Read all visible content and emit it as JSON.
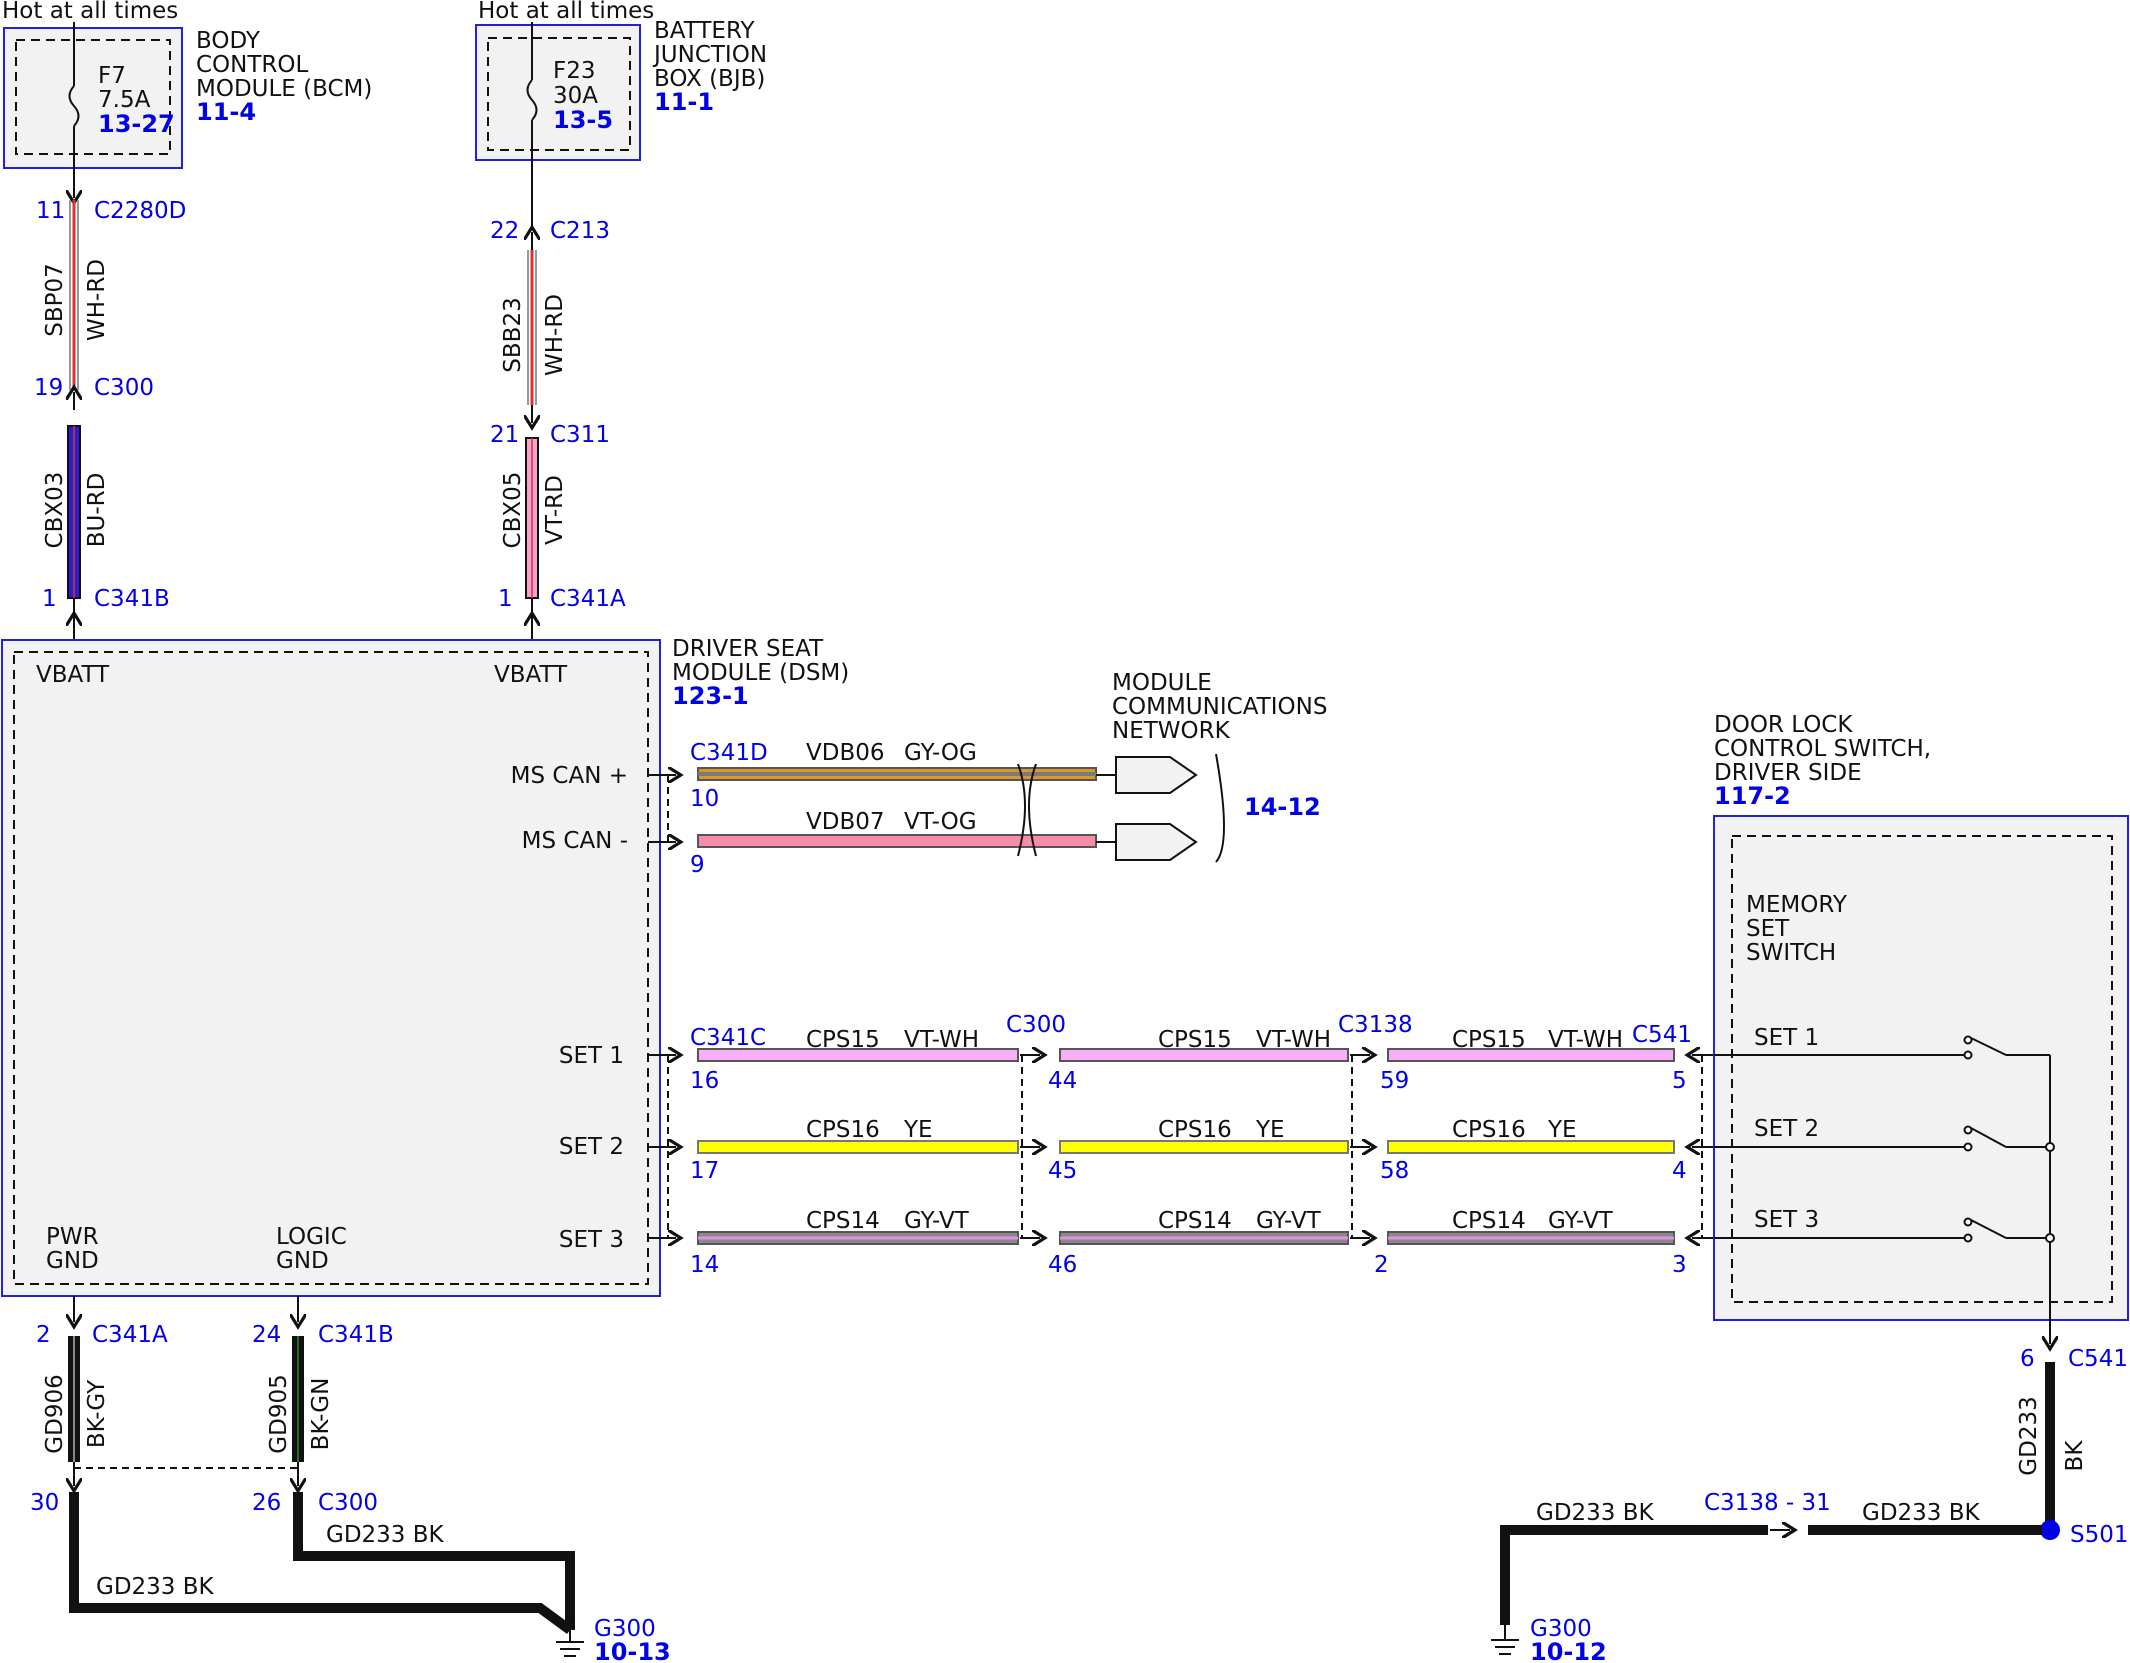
{
  "top_fuses": [
    {
      "supply": "Hot at all times",
      "fuse": "F7",
      "rating": "7.5A",
      "grid": "13-27",
      "module_lines": [
        "BODY",
        "CONTROL",
        "MODULE (BCM)"
      ],
      "module_ref": "11-4"
    },
    {
      "supply": "Hot at all times",
      "fuse": "F23",
      "rating": "30A",
      "grid": "13-5",
      "module_lines": [
        "BATTERY",
        "JUNCTION",
        "BOX (BJB)"
      ],
      "module_ref": "11-1"
    }
  ],
  "left_feed": {
    "pin_top": "11",
    "conn_top": "C2280D",
    "circuit_a": "SBP07",
    "color_a": "WH-RD",
    "pin_mid": "19",
    "conn_mid": "C300",
    "circuit_b": "CBX03",
    "color_b": "BU-RD",
    "pin_bot": "1",
    "conn_bot": "C341B"
  },
  "right_feed": {
    "pin_top": "22",
    "conn_top": "C213",
    "circuit_a": "SBB23",
    "color_a": "WH-RD",
    "pin_mid": "21",
    "conn_mid": "C311",
    "circuit_b": "CBX05",
    "color_b": "VT-RD",
    "pin_bot": "1",
    "conn_bot": "C341A"
  },
  "dsm": {
    "title_lines": [
      "DRIVER SEAT",
      "MODULE (DSM)"
    ],
    "ref": "123-1",
    "vbatt_left": "VBATT",
    "vbatt_right": "VBATT",
    "ms_can_plus": "MS CAN +",
    "ms_can_minus": "MS CAN -",
    "set1": "SET 1",
    "set2": "SET 2",
    "set3": "SET 3",
    "pwr_gnd": [
      "PWR",
      "GND"
    ],
    "logic_gnd": [
      "LOGIC",
      "GND"
    ]
  },
  "can": {
    "connector": "C341D",
    "plus": {
      "circuit": "VDB06",
      "color": "GY-OG",
      "pin": "10"
    },
    "minus": {
      "circuit": "VDB07",
      "color": "VT-OG",
      "pin": "9"
    },
    "network_lines": [
      "MODULE",
      "COMMUNICATIONS",
      "NETWORK"
    ],
    "network_ref": "14-12"
  },
  "set_circuits": {
    "connectors": [
      "C341C",
      "C300",
      "C3138",
      "C541"
    ],
    "rows": [
      {
        "circuit": "CPS15",
        "color": "VT-WH",
        "pins": [
          "16",
          "44",
          "59",
          "5"
        ]
      },
      {
        "circuit": "CPS16",
        "color": "YE",
        "pins": [
          "17",
          "45",
          "58",
          "4"
        ]
      },
      {
        "circuit": "CPS14",
        "color": "GY-VT",
        "pins": [
          "14",
          "46",
          "2",
          "3"
        ]
      }
    ]
  },
  "door_switch": {
    "title_lines": [
      "DOOR LOCK",
      "CONTROL SWITCH,",
      "DRIVER SIDE"
    ],
    "ref": "117-2",
    "inner_lines": [
      "MEMORY",
      "SET",
      "SWITCH"
    ],
    "set_labels": [
      "SET 1",
      "SET 2",
      "SET 3"
    ]
  },
  "ground_left": {
    "pwr_pin": "2",
    "pwr_conn": "C341A",
    "pwr_circuit": "GD906",
    "pwr_color": "BK-GY",
    "logic_pin": "24",
    "logic_conn": "C341B",
    "logic_circuit": "GD905",
    "logic_color": "BK-GN",
    "pin30": "30",
    "pin26": "26",
    "conn_c300": "C300",
    "wire_a": "GD233  BK",
    "wire_b": "GD233  BK",
    "ground": "G300",
    "ground_ref": "10-13"
  },
  "ground_right": {
    "pin": "6",
    "conn": "C541",
    "circuit": "GD233",
    "color": "BK",
    "splice": "S501",
    "inline_conn": "C3138 - 31",
    "wire_a": "GD233  BK",
    "wire_b": "GD233  BK",
    "ground": "G300",
    "ground_ref": "10-12"
  },
  "colors": {
    "link_blue": "#0000e6",
    "box_fill": "#f2f2f2",
    "yellow": "#ffff00",
    "pink_vt": "#f7a1f7",
    "blue_bu": "#2a1fd0"
  }
}
